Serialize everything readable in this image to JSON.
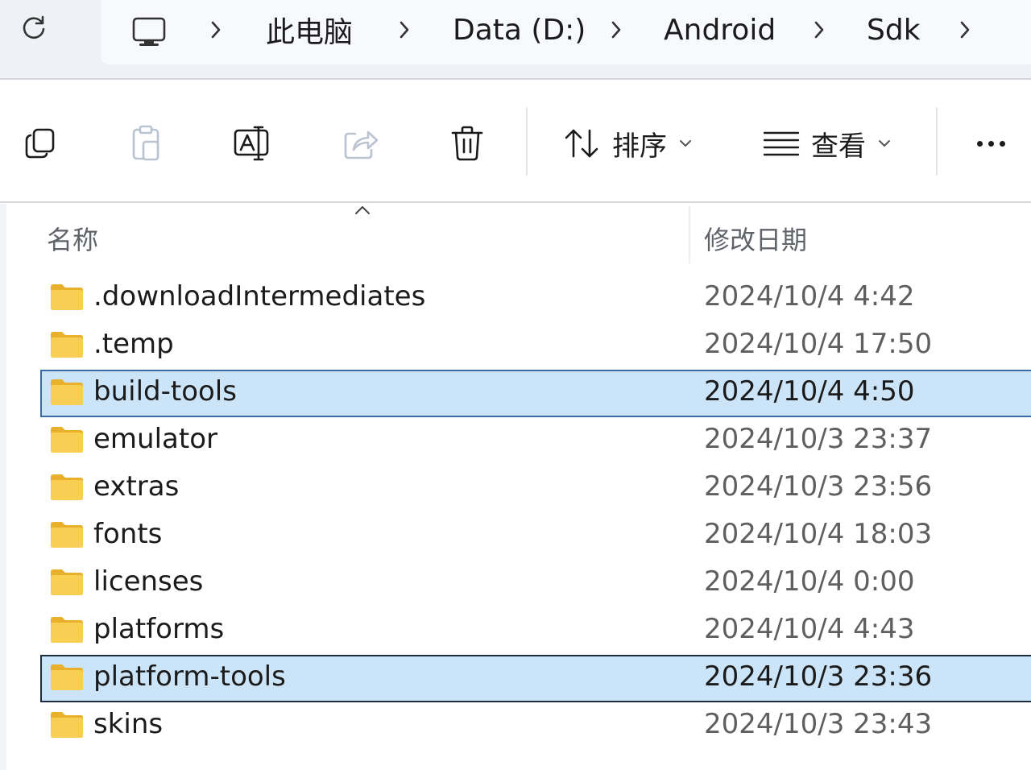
{
  "address": {
    "breadcrumbs": [
      "此电脑",
      "Data (D:)",
      "Android",
      "Sdk"
    ],
    "icons": {
      "refresh": "refresh-icon",
      "pc": "computer-icon",
      "separator": "chevron-right-icon"
    }
  },
  "toolbar": {
    "buttons": [
      "copy-icon",
      "paste-icon",
      "rename-icon",
      "share-icon",
      "delete-icon"
    ],
    "sort_label": "排序",
    "view_label": "查看",
    "more": "more-icon"
  },
  "list": {
    "columns": {
      "name": "名称",
      "date": "修改日期"
    },
    "rows": [
      {
        "name": ".downloadIntermediates",
        "date": "2024/10/4 4:42",
        "selected": false
      },
      {
        "name": ".temp",
        "date": "2024/10/4 17:50",
        "selected": false
      },
      {
        "name": "build-tools",
        "date": "2024/10/4 4:50",
        "selected": true
      },
      {
        "name": "emulator",
        "date": "2024/10/3 23:37",
        "selected": false
      },
      {
        "name": "extras",
        "date": "2024/10/3 23:56",
        "selected": false
      },
      {
        "name": "fonts",
        "date": "2024/10/4 18:03",
        "selected": false
      },
      {
        "name": "licenses",
        "date": "2024/10/4 0:00",
        "selected": false
      },
      {
        "name": "platforms",
        "date": "2024/10/4 4:43",
        "selected": false
      },
      {
        "name": "platform-tools",
        "date": "2024/10/3 23:36",
        "selected": true
      },
      {
        "name": "skins",
        "date": "2024/10/3 23:43",
        "selected": false
      }
    ]
  },
  "colors": {
    "selection": "#cce4f7",
    "selection_border": "#3a6aa5",
    "folder": "#f8c94a"
  }
}
